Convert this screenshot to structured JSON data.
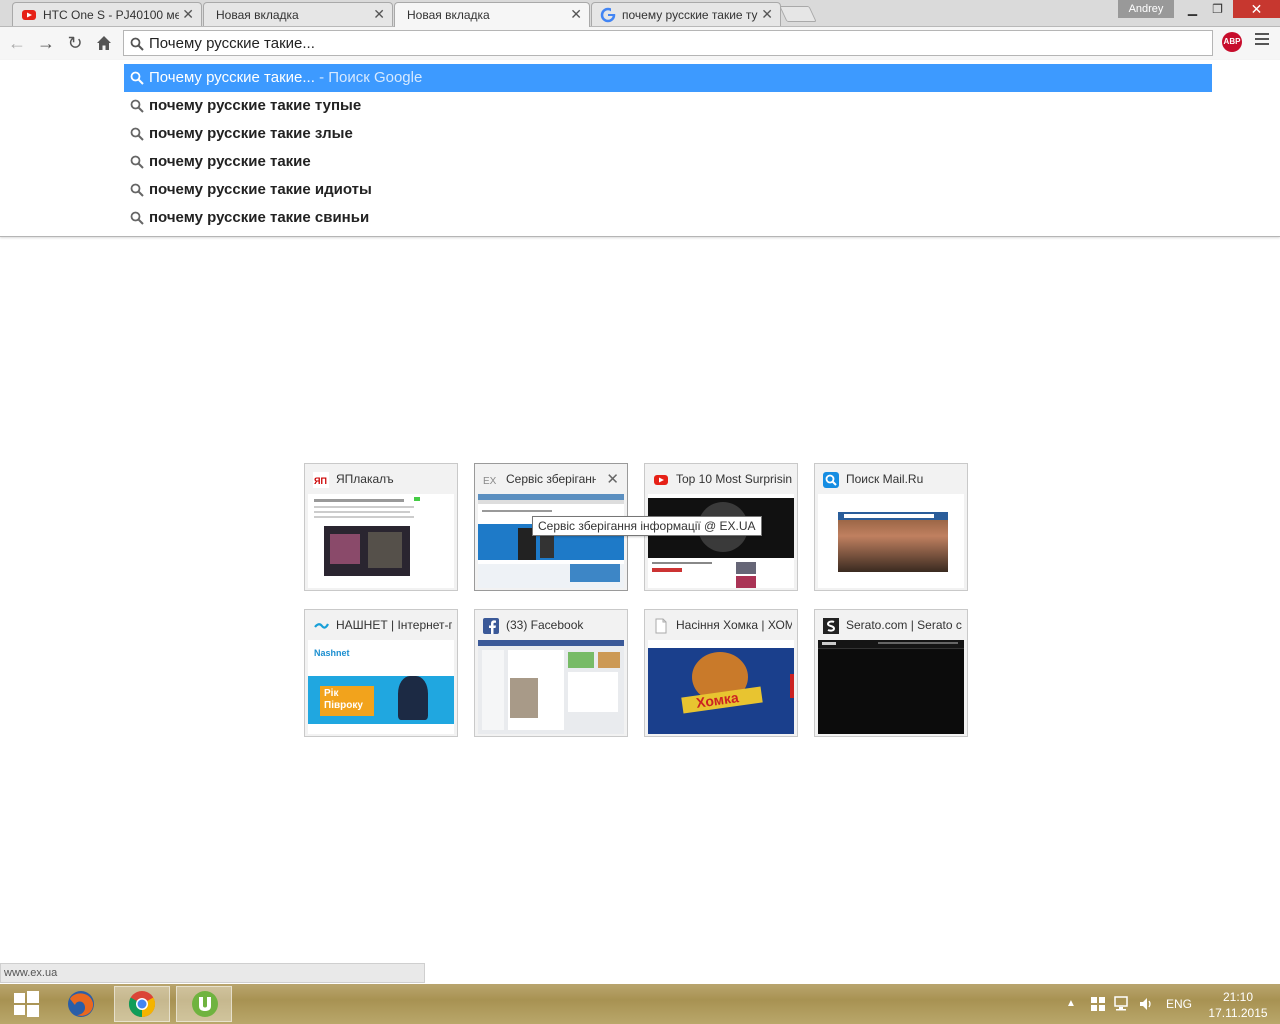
{
  "tabs": [
    {
      "title": "HTC One S - PJ40100 мен",
      "icon": "youtube-icon",
      "active": false
    },
    {
      "title": "Новая вкладка",
      "icon": "",
      "active": false
    },
    {
      "title": "Новая вкладка",
      "icon": "",
      "active": true
    },
    {
      "title": "почему русские такие ту",
      "icon": "google-icon",
      "active": false
    }
  ],
  "window": {
    "user": "Andrey"
  },
  "omnibox": {
    "value": "Почему русские такие..."
  },
  "suggestions": [
    {
      "text": "Почему русские такие...",
      "hint": "- Поиск Google",
      "selected": true
    },
    {
      "text": "почему русские такие тупые"
    },
    {
      "text": "почему русские такие злые"
    },
    {
      "text": "почему русские такие"
    },
    {
      "text": "почему русские такие идиоты"
    },
    {
      "text": "почему русские такие свиньи"
    }
  ],
  "tiles": [
    {
      "title": "ЯПлакалъ",
      "icon": "yaplakal-icon"
    },
    {
      "title": "Сервіс зберігання",
      "icon": "exua-icon"
    },
    {
      "title": "Top 10 Most Surprisin",
      "icon": "youtube-icon"
    },
    {
      "title": "Поиск Mail.Ru",
      "icon": "mailru-search-icon"
    },
    {
      "title": "НАШНЕТ | Інтернет-п",
      "icon": "nashnet-icon"
    },
    {
      "title": "(33) Facebook",
      "icon": "facebook-icon"
    },
    {
      "title": "Насіння Хомка | ХОМ",
      "icon": "page-icon"
    },
    {
      "title": "Serato.com | Serato c",
      "icon": "serato-icon"
    }
  ],
  "tile_icon_labels": {
    "yaplakal": "ЯП",
    "exua": "EX"
  },
  "thumbnail_texts": {
    "nashnet_brand": "Nashnet",
    "nashnet_promo_1": "Рік",
    "nashnet_promo_2": "Півроку",
    "khomka_brand": "Хомка"
  },
  "tooltip": "Сервіс зберігання інформації @ EX.UA",
  "status_url": "www.ex.ua",
  "taskbar": {
    "lang": "ENG",
    "time": "21:10",
    "date": "17.11.2015"
  },
  "colors": {
    "selection": "#3d9aff",
    "abp": "#c70d2c",
    "close": "#c7372f"
  }
}
